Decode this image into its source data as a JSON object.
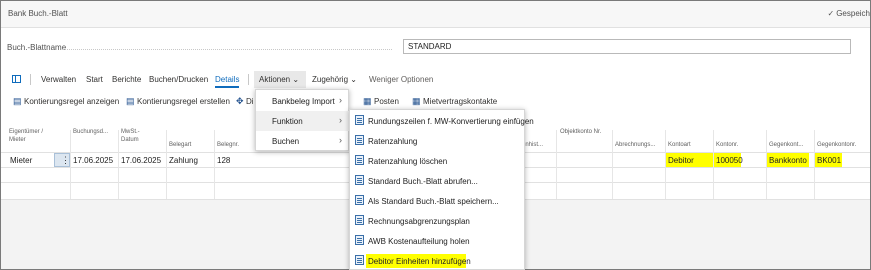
{
  "window": {
    "title": "Bank Buch.-Blatt",
    "saved_status": "Gespeich"
  },
  "batch_field": {
    "label": "Buch.-Blattname",
    "value": "STANDARD"
  },
  "toolbar": {
    "items": [
      "Verwalten",
      "Start",
      "Berichte",
      "Buchen/Drucken",
      "Details",
      "Aktionen",
      "Zugehörig",
      "Weniger Optionen"
    ],
    "active_tab": "Details",
    "open_menu": "Aktionen"
  },
  "actionbar": {
    "items": [
      "Kontierungsregel anzeigen",
      "Kontierungsregel erstellen",
      "Di",
      "Posten",
      "Mietvertragskontakte"
    ]
  },
  "grid": {
    "headers": [
      "Eigentümer / Mieter",
      "Buchungsd...",
      "MwSt.-Datum",
      "Belegart",
      "Belegnr.",
      "enhist...",
      "Objektkonto Nr.",
      "Abrechnungs...",
      "Kontoart",
      "Kontonr.",
      "Gegenkont...",
      "Gegenkontonr."
    ],
    "row": {
      "owner": "Mieter",
      "posting_date": "17.06.2025",
      "vat_date": "17.06.2025",
      "doc_type": "Zahlung",
      "doc_no": "128",
      "account_type": "Debitor",
      "account_no": "100050",
      "bal_account_type": "Bankkonto",
      "bal_account_no": "BK001"
    },
    "highlight_color": "#ffff00"
  },
  "menu_level1": {
    "items": [
      {
        "label": "Bankbeleg Import"
      },
      {
        "label": "Funktion"
      },
      {
        "label": "Buchen"
      }
    ],
    "selected": "Funktion"
  },
  "menu_level2": {
    "items": [
      {
        "label": "Rundungszeilen f. MW-Konvertierung einfügen",
        "icon": "insert-lines-icon"
      },
      {
        "label": "Ratenzahlung",
        "icon": "document-icon"
      },
      {
        "label": "Ratenzahlung löschen",
        "icon": "document-icon"
      },
      {
        "label": "Standard Buch.-Blatt abrufen...",
        "icon": "document-icon"
      },
      {
        "label": "Als Standard Buch.-Blatt speichern...",
        "icon": "document-icon"
      },
      {
        "label": "Rechnungsabgrenzungsplan",
        "icon": "document-icon"
      },
      {
        "label": "AWB Kostenaufteilung holen",
        "icon": "document-icon"
      },
      {
        "label": "Debitor Einheiten hinzufügen",
        "icon": "document-icon"
      }
    ],
    "highlighted": "Debitor Einheiten hinzufügen"
  }
}
